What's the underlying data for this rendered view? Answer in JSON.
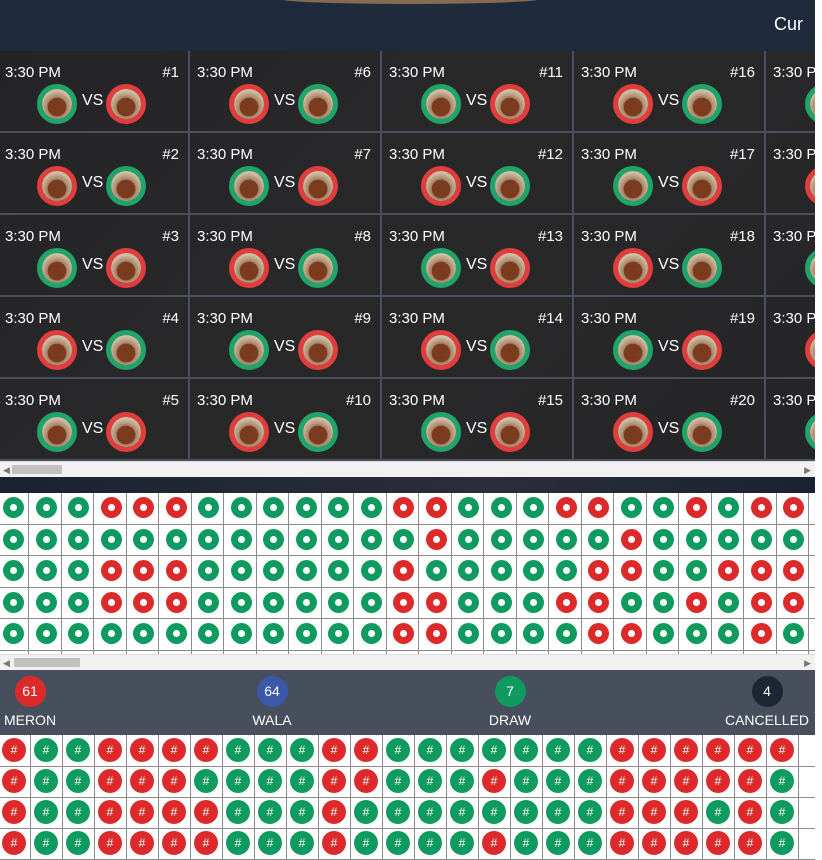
{
  "header": {
    "title_partial": "Cur"
  },
  "matches": [
    {
      "time": "3:30 PM",
      "num": "#1",
      "left": "green",
      "right": "red"
    },
    {
      "time": "3:30 PM",
      "num": "#2",
      "left": "red",
      "right": "green"
    },
    {
      "time": "3:30 PM",
      "num": "#3",
      "left": "green",
      "right": "red"
    },
    {
      "time": "3:30 PM",
      "num": "#4",
      "left": "red",
      "right": "green"
    },
    {
      "time": "3:30 PM",
      "num": "#5",
      "left": "green",
      "right": "red"
    },
    {
      "time": "3:30 PM",
      "num": "#6",
      "left": "red",
      "right": "green"
    },
    {
      "time": "3:30 PM",
      "num": "#7",
      "left": "green",
      "right": "red"
    },
    {
      "time": "3:30 PM",
      "num": "#8",
      "left": "red",
      "right": "green"
    },
    {
      "time": "3:30 PM",
      "num": "#9",
      "left": "green",
      "right": "red"
    },
    {
      "time": "3:30 PM",
      "num": "#10",
      "left": "red",
      "right": "green"
    },
    {
      "time": "3:30 PM",
      "num": "#11",
      "left": "green",
      "right": "red"
    },
    {
      "time": "3:30 PM",
      "num": "#12",
      "left": "red",
      "right": "green"
    },
    {
      "time": "3:30 PM",
      "num": "#13",
      "left": "green",
      "right": "red"
    },
    {
      "time": "3:30 PM",
      "num": "#14",
      "left": "red",
      "right": "green"
    },
    {
      "time": "3:30 PM",
      "num": "#15",
      "left": "green",
      "right": "red"
    },
    {
      "time": "3:30 PM",
      "num": "#16",
      "left": "red",
      "right": "green"
    },
    {
      "time": "3:30 PM",
      "num": "#17",
      "left": "green",
      "right": "red"
    },
    {
      "time": "3:30 PM",
      "num": "#18",
      "left": "red",
      "right": "green"
    },
    {
      "time": "3:30 PM",
      "num": "#19",
      "left": "green",
      "right": "red"
    },
    {
      "time": "3:30 PM",
      "num": "#20",
      "left": "red",
      "right": "green"
    },
    {
      "time": "3:30 P",
      "num": "",
      "left": "green",
      "right": ""
    },
    {
      "time": "3:30 P",
      "num": "",
      "left": "red",
      "right": ""
    },
    {
      "time": "3:30 P",
      "num": "",
      "left": "green",
      "right": ""
    },
    {
      "time": "3:30 P",
      "num": "",
      "left": "red",
      "right": ""
    },
    {
      "time": "3:30 P",
      "num": "",
      "left": "green",
      "right": ""
    }
  ],
  "match_vs_label": "VS",
  "bead_road": {
    "rows": [
      "GGGRRRGGGGGGRRGGGRRGGRGRR",
      "GGGGGGGGGGGGGRGGGGGRGGGGG",
      "GGGRRRGGGGGGRGGGGGRRGGRRR",
      "GGGRRRGGGGGGRRGGGRRGGRGRR",
      "GGGGGGGGGGGGRRGGGGRRGGGRG"
    ]
  },
  "summary": [
    {
      "count": "61",
      "label": "MERON",
      "color": "#dc2a2a"
    },
    {
      "count": "64",
      "label": "WALA",
      "color": "#3b59a8"
    },
    {
      "count": "7",
      "label": "DRAW",
      "color": "#0f9a5f"
    },
    {
      "count": "4",
      "label": "CANCELLED",
      "color": "#1f2633"
    }
  ],
  "hash_road": {
    "symbol": "#",
    "rows": [
      "RGGRRRRGGGRRGGGGGGGRRRRRR",
      "RGGRRRGGGGRRGGGRGGGRRRRRG",
      "RGGRRRRGGGRGGGGGGGGRRRGRG",
      "RGGRRRRGGGRGGGGRGGGRRRRRG"
    ]
  },
  "colors": {
    "green": "#0f9a5f",
    "red": "#dc2a2a"
  }
}
